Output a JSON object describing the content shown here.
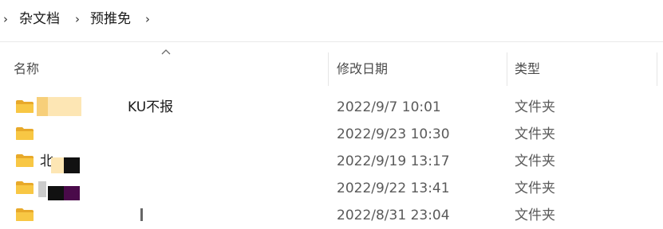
{
  "breadcrumb": {
    "items": [
      "杂文档",
      "预推免"
    ],
    "separator_glyph": "›"
  },
  "columns": {
    "name": "名称",
    "date_modified": "修改日期",
    "type": "类型",
    "sort_indicator": "ascending"
  },
  "files": [
    {
      "name": "KU不报",
      "date": "2022/9/7 10:01",
      "type": "文件夹"
    },
    {
      "name": "",
      "date": "2022/9/23 10:30",
      "type": "文件夹"
    },
    {
      "name": "北",
      "date": "2022/9/19 13:17",
      "type": "文件夹"
    },
    {
      "name": "",
      "date": "2022/9/22 13:41",
      "type": "文件夹"
    },
    {
      "name": "",
      "date": "2022/8/31 23:04",
      "type": "文件夹"
    }
  ],
  "colors": {
    "folder_body": "#f8c744",
    "folder_tab": "#e8a92a",
    "header_text": "#4b4b4b",
    "date_text": "#5a5a5a"
  },
  "icons": {
    "folder": "folder-icon",
    "chevron": "chevron-right-icon",
    "sort": "sort-up-icon"
  }
}
